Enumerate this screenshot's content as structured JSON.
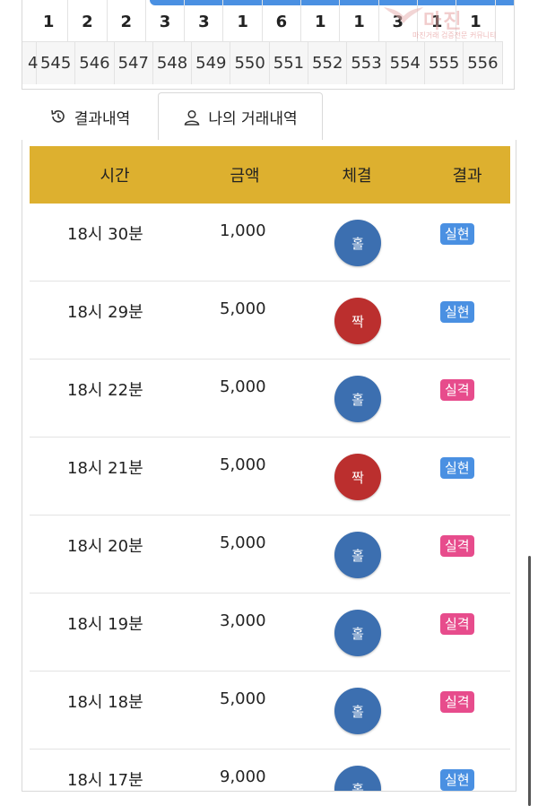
{
  "grid": {
    "counts": [
      "1",
      "2",
      "2",
      "3",
      "3",
      "1",
      "6",
      "1",
      "1",
      "3",
      "1",
      "1"
    ],
    "rounds_partial": "4",
    "rounds": [
      "545",
      "546",
      "547",
      "548",
      "549",
      "550",
      "551",
      "552",
      "553",
      "554",
      "555",
      "556"
    ]
  },
  "watermark": {
    "title": "마진",
    "subtitle": "마진거래 검증전문 커뮤니티"
  },
  "tabs": [
    {
      "label": "결과내역",
      "icon": "history-icon"
    },
    {
      "label": "나의 거래내역",
      "icon": "user-icon"
    }
  ],
  "table": {
    "headers": [
      "시간",
      "금액",
      "체결",
      "결과"
    ],
    "rows": [
      {
        "time": "18시 30분",
        "amount": "1,000",
        "pick": "홀",
        "pick_color": "blue",
        "result": "실현",
        "result_type": "ok"
      },
      {
        "time": "18시 29분",
        "amount": "5,000",
        "pick": "짝",
        "pick_color": "red",
        "result": "실현",
        "result_type": "ok"
      },
      {
        "time": "18시 22분",
        "amount": "5,000",
        "pick": "홀",
        "pick_color": "blue",
        "result": "실격",
        "result_type": "fail"
      },
      {
        "time": "18시 21분",
        "amount": "5,000",
        "pick": "짝",
        "pick_color": "red",
        "result": "실현",
        "result_type": "ok"
      },
      {
        "time": "18시 20분",
        "amount": "5,000",
        "pick": "홀",
        "pick_color": "blue",
        "result": "실격",
        "result_type": "fail"
      },
      {
        "time": "18시 19분",
        "amount": "3,000",
        "pick": "홀",
        "pick_color": "blue",
        "result": "실격",
        "result_type": "fail"
      },
      {
        "time": "18시 18분",
        "amount": "5,000",
        "pick": "홀",
        "pick_color": "blue",
        "result": "실격",
        "result_type": "fail"
      },
      {
        "time": "18시 17분",
        "amount": "9,000",
        "pick": "홀",
        "pick_color": "blue",
        "result": "실현",
        "result_type": "ok"
      }
    ]
  },
  "colors": {
    "header_bg": "#ddb02f",
    "odd_ball": "#3c6fb0",
    "even_ball": "#bb2f2e",
    "success_badge": "#4a90e2",
    "fail_badge": "#e74c8c"
  }
}
